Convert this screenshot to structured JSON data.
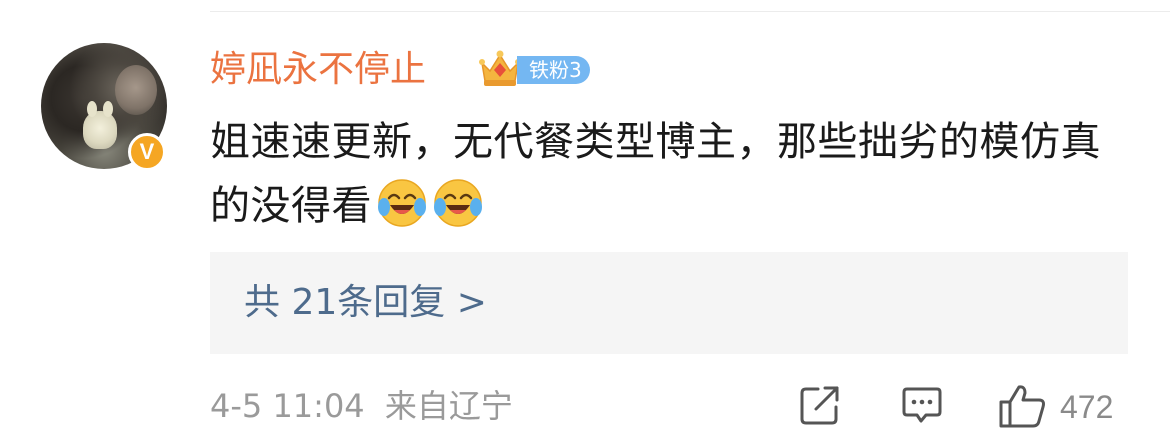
{
  "comment": {
    "username": "婷凪永不停止",
    "fan_badge": {
      "label": "铁粉3",
      "color": "#74b7f2",
      "icon": "crown-icon"
    },
    "avatar_badge": "V",
    "text": "姐速速更新，无代餐类型博主，那些拙劣的模仿真的没得看",
    "emojis": [
      "laugh-cry-emoji",
      "laugh-cry-emoji"
    ],
    "replies_link": "共 21条回复 >",
    "date": "4-5 11:04",
    "location": "来自辽宁",
    "like_count": "472"
  },
  "colors": {
    "username": "#eb7340",
    "reply_link": "#4e6b8c",
    "meta": "#9a9a9a",
    "verified": "#f5a623"
  },
  "icons": [
    "share-icon",
    "comment-icon",
    "like-icon"
  ]
}
